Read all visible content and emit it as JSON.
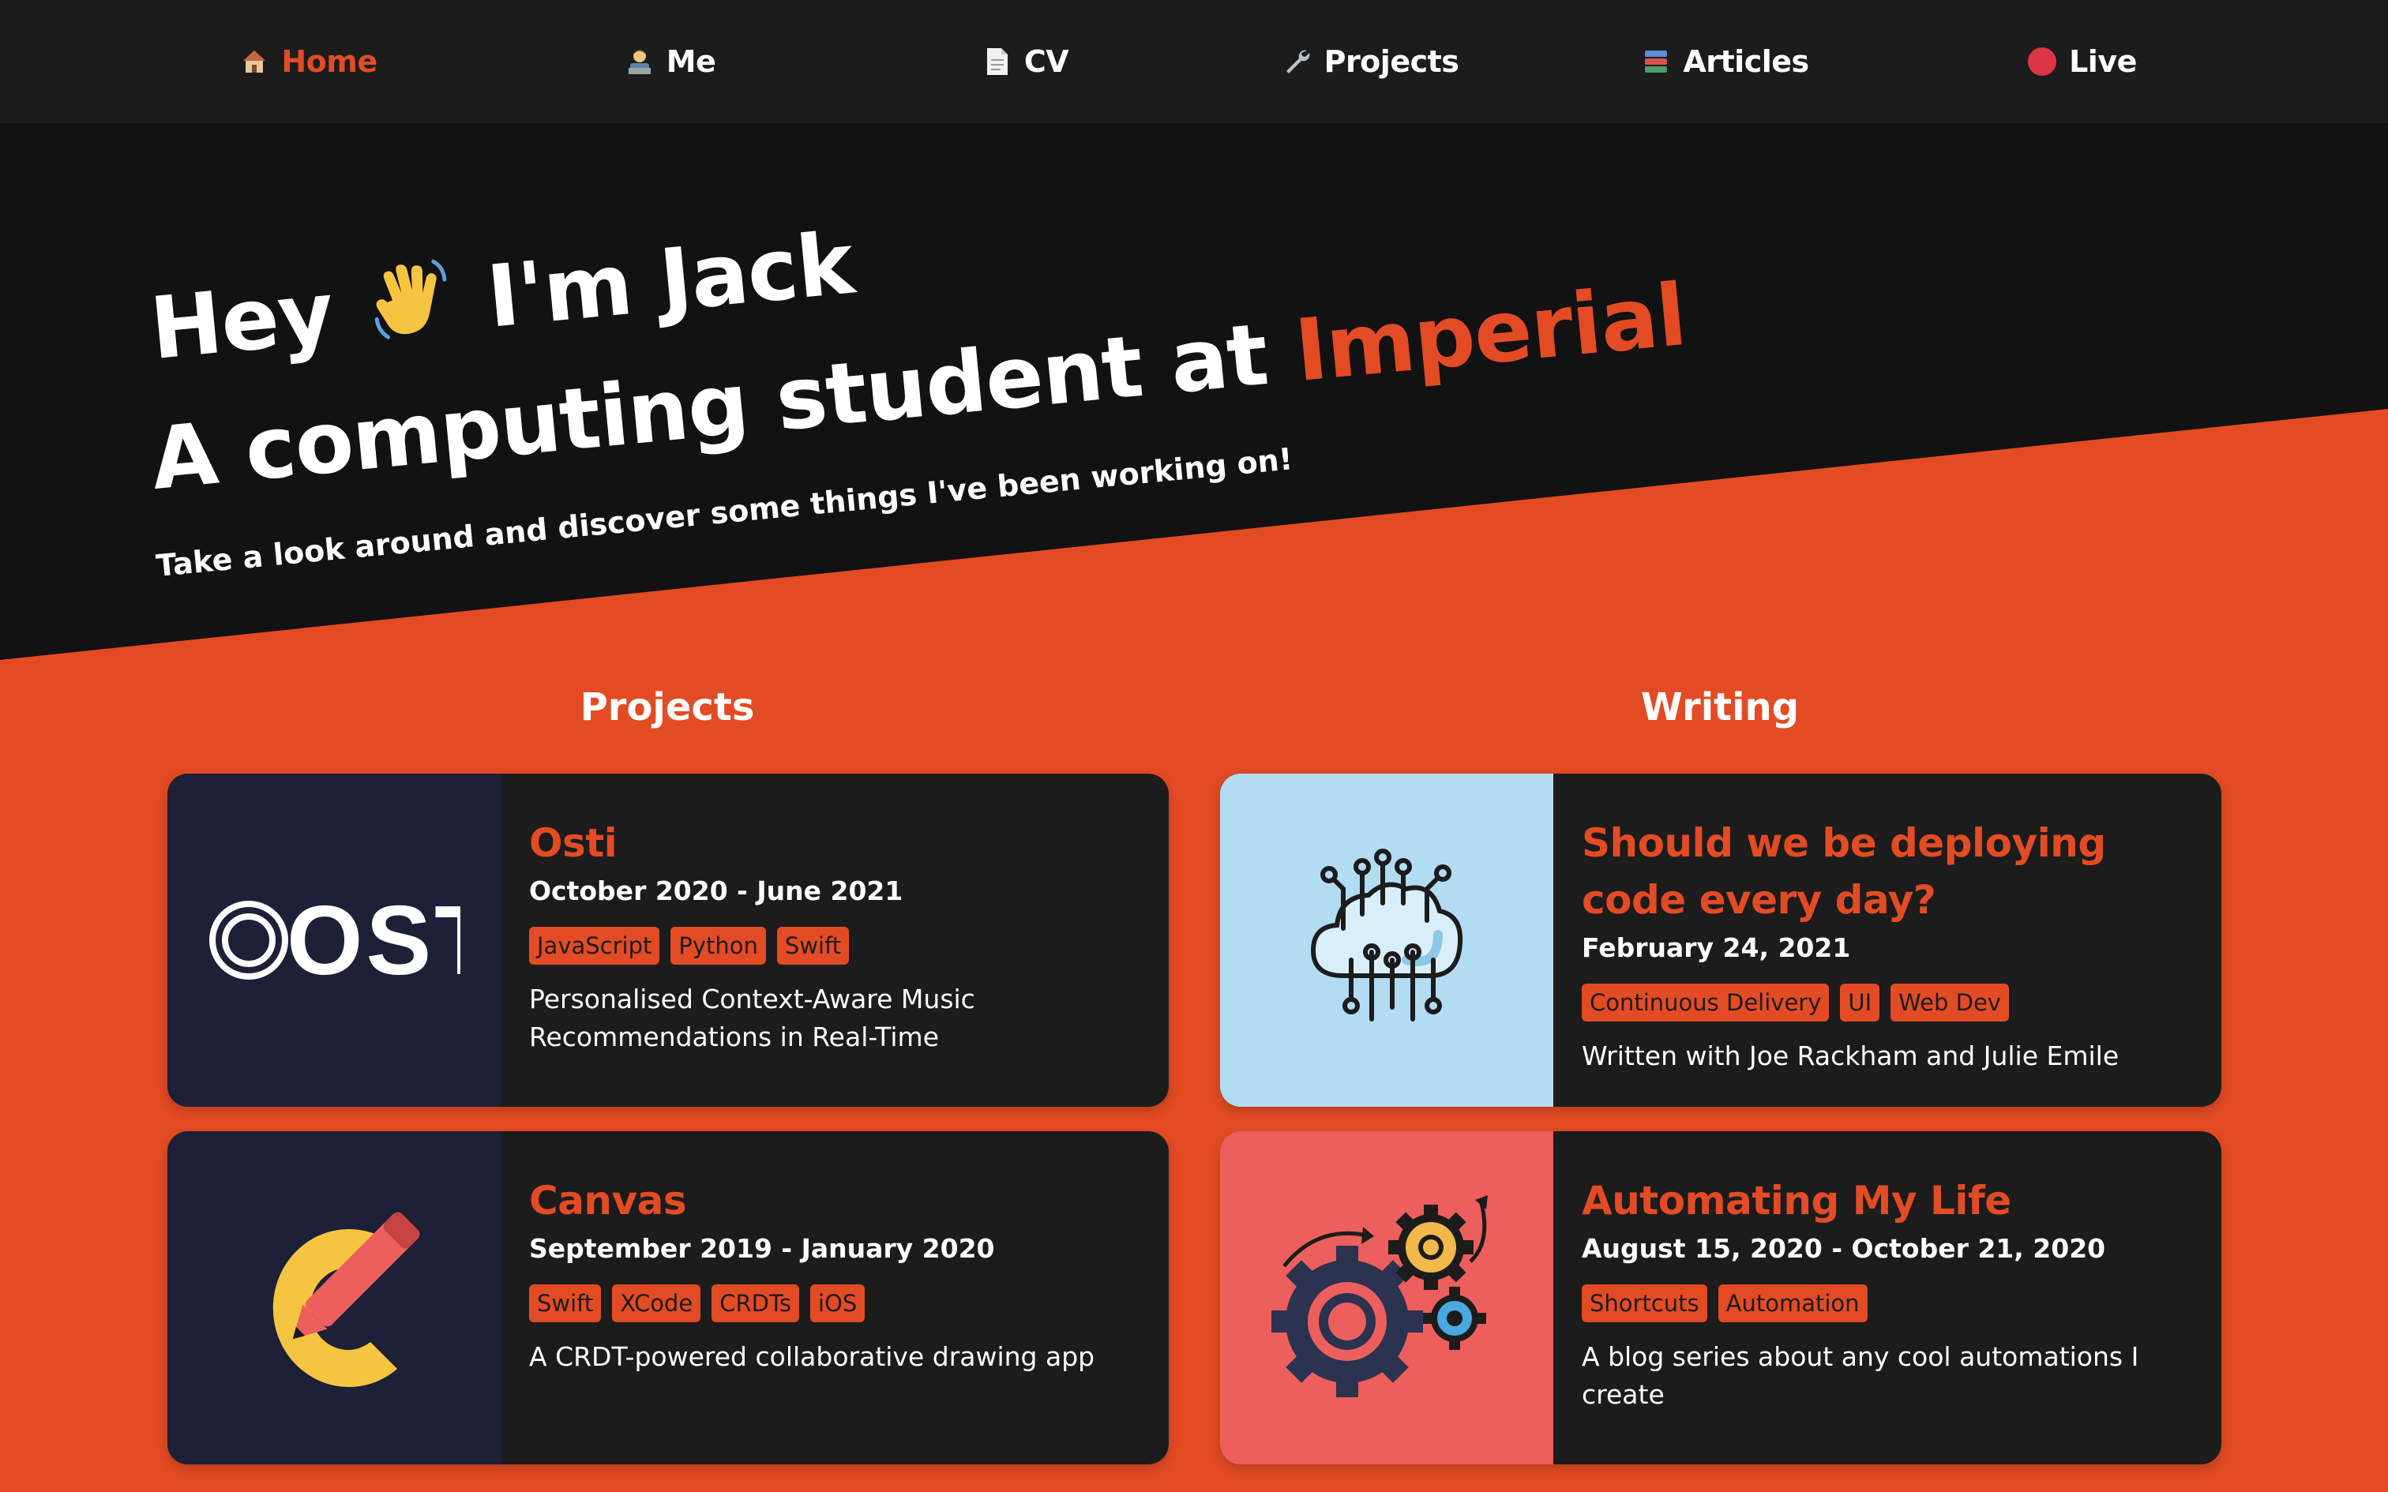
{
  "nav": {
    "items": [
      {
        "label": "Home",
        "icon": "house-icon",
        "active": true
      },
      {
        "label": "Me",
        "icon": "technologist-icon",
        "active": false
      },
      {
        "label": "CV",
        "icon": "document-icon",
        "active": false
      },
      {
        "label": "Projects",
        "icon": "wrench-icon",
        "active": false
      },
      {
        "label": "Articles",
        "icon": "books-icon",
        "active": false
      },
      {
        "label": "Live",
        "icon": "red-circle-icon",
        "active": false
      }
    ]
  },
  "hero": {
    "greeting_prefix": "Hey",
    "greeting_suffix": "I'm Jack",
    "tagline_prefix": "A computing student at",
    "tagline_accent": "Imperial",
    "subtitle": "Take a look around and discover some things I've been working on!"
  },
  "sections": {
    "projects_title": "Projects",
    "writing_title": "Writing"
  },
  "projects": [
    {
      "title": "Osti",
      "date": "October 2020 - June 2021",
      "tags": [
        "JavaScript",
        "Python",
        "Swift"
      ],
      "description": "Personalised Context-Aware Music Recommendations in Real-Time",
      "logo_text": "OSTI"
    },
    {
      "title": "Canvas",
      "date": "September 2019 - January 2020",
      "tags": [
        "Swift",
        "XCode",
        "CRDTs",
        "iOS"
      ],
      "description": "A CRDT-powered collaborative drawing app"
    }
  ],
  "articles": [
    {
      "title": "Should we be deploying code every day?",
      "date": "February 24, 2021",
      "tags": [
        "Continuous Delivery",
        "UI",
        "Web Dev"
      ],
      "description": "Written with Joe Rackham and Julie Emile"
    },
    {
      "title": "Automating My Life",
      "date": "August 15, 2020 - October 21, 2020",
      "tags": [
        "Shortcuts",
        "Automation"
      ],
      "description": "A blog series about any cool automations I create"
    }
  ],
  "colors": {
    "accent": "#e34b24",
    "dark": "#1c1c1c",
    "hero_bg": "#121212",
    "thumb_navy": "#1d2036",
    "thumb_sky": "#b2dcf2",
    "thumb_coral": "#ec5f5c"
  }
}
